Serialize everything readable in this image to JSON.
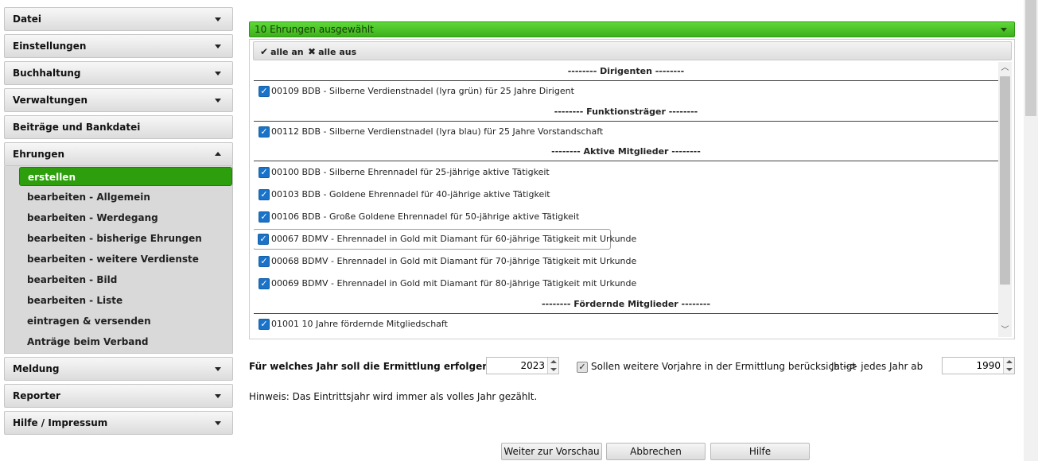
{
  "sidebar": {
    "sections": [
      {
        "label": "Datei"
      },
      {
        "label": "Einstellungen"
      },
      {
        "label": "Buchhaltung"
      },
      {
        "label": "Verwaltungen"
      },
      {
        "label": "Beiträge und Bankdatei"
      },
      {
        "label": "Ehrungen"
      },
      {
        "label": "Meldung"
      },
      {
        "label": "Reporter"
      },
      {
        "label": "Hilfe / Impressum"
      }
    ],
    "ehrungen_items": [
      {
        "label": "erstellen",
        "active": true
      },
      {
        "label": "bearbeiten - Allgemein"
      },
      {
        "label": "bearbeiten - Werdegang"
      },
      {
        "label": "bearbeiten - bisherige Ehrungen"
      },
      {
        "label": "bearbeiten - weitere Verdienste"
      },
      {
        "label": "bearbeiten - Bild"
      },
      {
        "label": "bearbeiten - Liste"
      },
      {
        "label": "eintragen & versenden"
      },
      {
        "label": "Anträge beim Verband"
      }
    ]
  },
  "selection": {
    "summary": "10 Ehrungen ausgewählt",
    "all_on": "alle an",
    "all_off": "alle aus"
  },
  "groups": {
    "dirigenten": "-------- Dirigenten --------",
    "funktionstraeger": "-------- Funktionsträger --------",
    "aktive": "-------- Aktive Mitglieder --------",
    "foerdernde": "-------- Fördernde Mitglieder --------"
  },
  "items": [
    {
      "label": "00109 BDB - Silberne Verdienstnadel (lyra grün) für 25 Jahre Dirigent",
      "checked": true
    },
    {
      "label": "00112 BDB - Silberne Verdienstnadel (lyra blau) für 25 Jahre Vorstandschaft",
      "checked": true
    },
    {
      "label": "00100 BDB - Silberne Ehrennadel für 25-jährige aktive Tätigkeit",
      "checked": true
    },
    {
      "label": "00103 BDB - Goldene Ehrennadel für 40-jährige aktive Tätigkeit",
      "checked": true
    },
    {
      "label": "00106 BDB - Große Goldene Ehrennadel für 50-jährige aktive Tätigkeit",
      "checked": true
    },
    {
      "label": "00067 BDMV - Ehrennadel in Gold mit Diamant für 60-jährige Tätigkeit mit Urkunde",
      "checked": true
    },
    {
      "label": "00068 BDMV - Ehrennadel in Gold mit Diamant für 70-jährige Tätigkeit mit Urkunde",
      "checked": true
    },
    {
      "label": "00069 BDMV - Ehrennadel in Gold mit Diamant für 80-jährige Tätigkeit mit Urkunde",
      "checked": true
    },
    {
      "label": "01001 10 Jahre fördernde Mitgliedschaft",
      "checked": true
    }
  ],
  "form": {
    "year_question": "Für welches Jahr soll die Ermittlung erfolgen?",
    "year_value": "2023",
    "prev_years_label": "Sollen weitere Vorjahre in der Ermittlung berücksichtigt",
    "prev_years_checked": true,
    "from_label": "Ja --> jedes Jahr ab",
    "from_value": "1990",
    "hint": "Hinweis: Das Eintrittsjahr wird immer als volles Jahr gezählt."
  },
  "buttons": {
    "preview": "Weiter zur Vorschau",
    "cancel": "Abbrechen",
    "help": "Hilfe"
  },
  "colors": {
    "accent_green": "#3cb01a",
    "checkbox_blue": "#1a73c9"
  }
}
